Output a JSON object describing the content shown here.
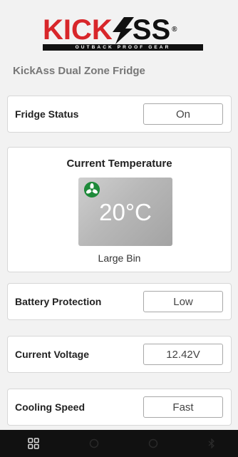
{
  "brand": {
    "logo_name": "KickAss",
    "logo_tagline": "OUTBACK PROOF GEAR"
  },
  "device": {
    "name": "KickAss Dual Zone Fridge"
  },
  "fridge_status": {
    "label": "Fridge Status",
    "value": "On"
  },
  "temperature": {
    "title": "Current Temperature",
    "value": "20°C",
    "bin": "Large Bin",
    "fan_icon": "fan-icon",
    "fan_color": "#1e8a3a"
  },
  "battery_protection": {
    "label": "Battery Protection",
    "value": "Low"
  },
  "voltage": {
    "label": "Current Voltage",
    "value": "12.42V"
  },
  "cooling_speed": {
    "label": "Cooling Speed",
    "value": "Fast"
  },
  "bottom_nav": {
    "icons": [
      "grid-icon",
      "circle-icon",
      "circle-icon",
      "bluetooth-icon"
    ]
  },
  "colors": {
    "brand_red": "#d8262a",
    "nav_bg": "#111111"
  }
}
